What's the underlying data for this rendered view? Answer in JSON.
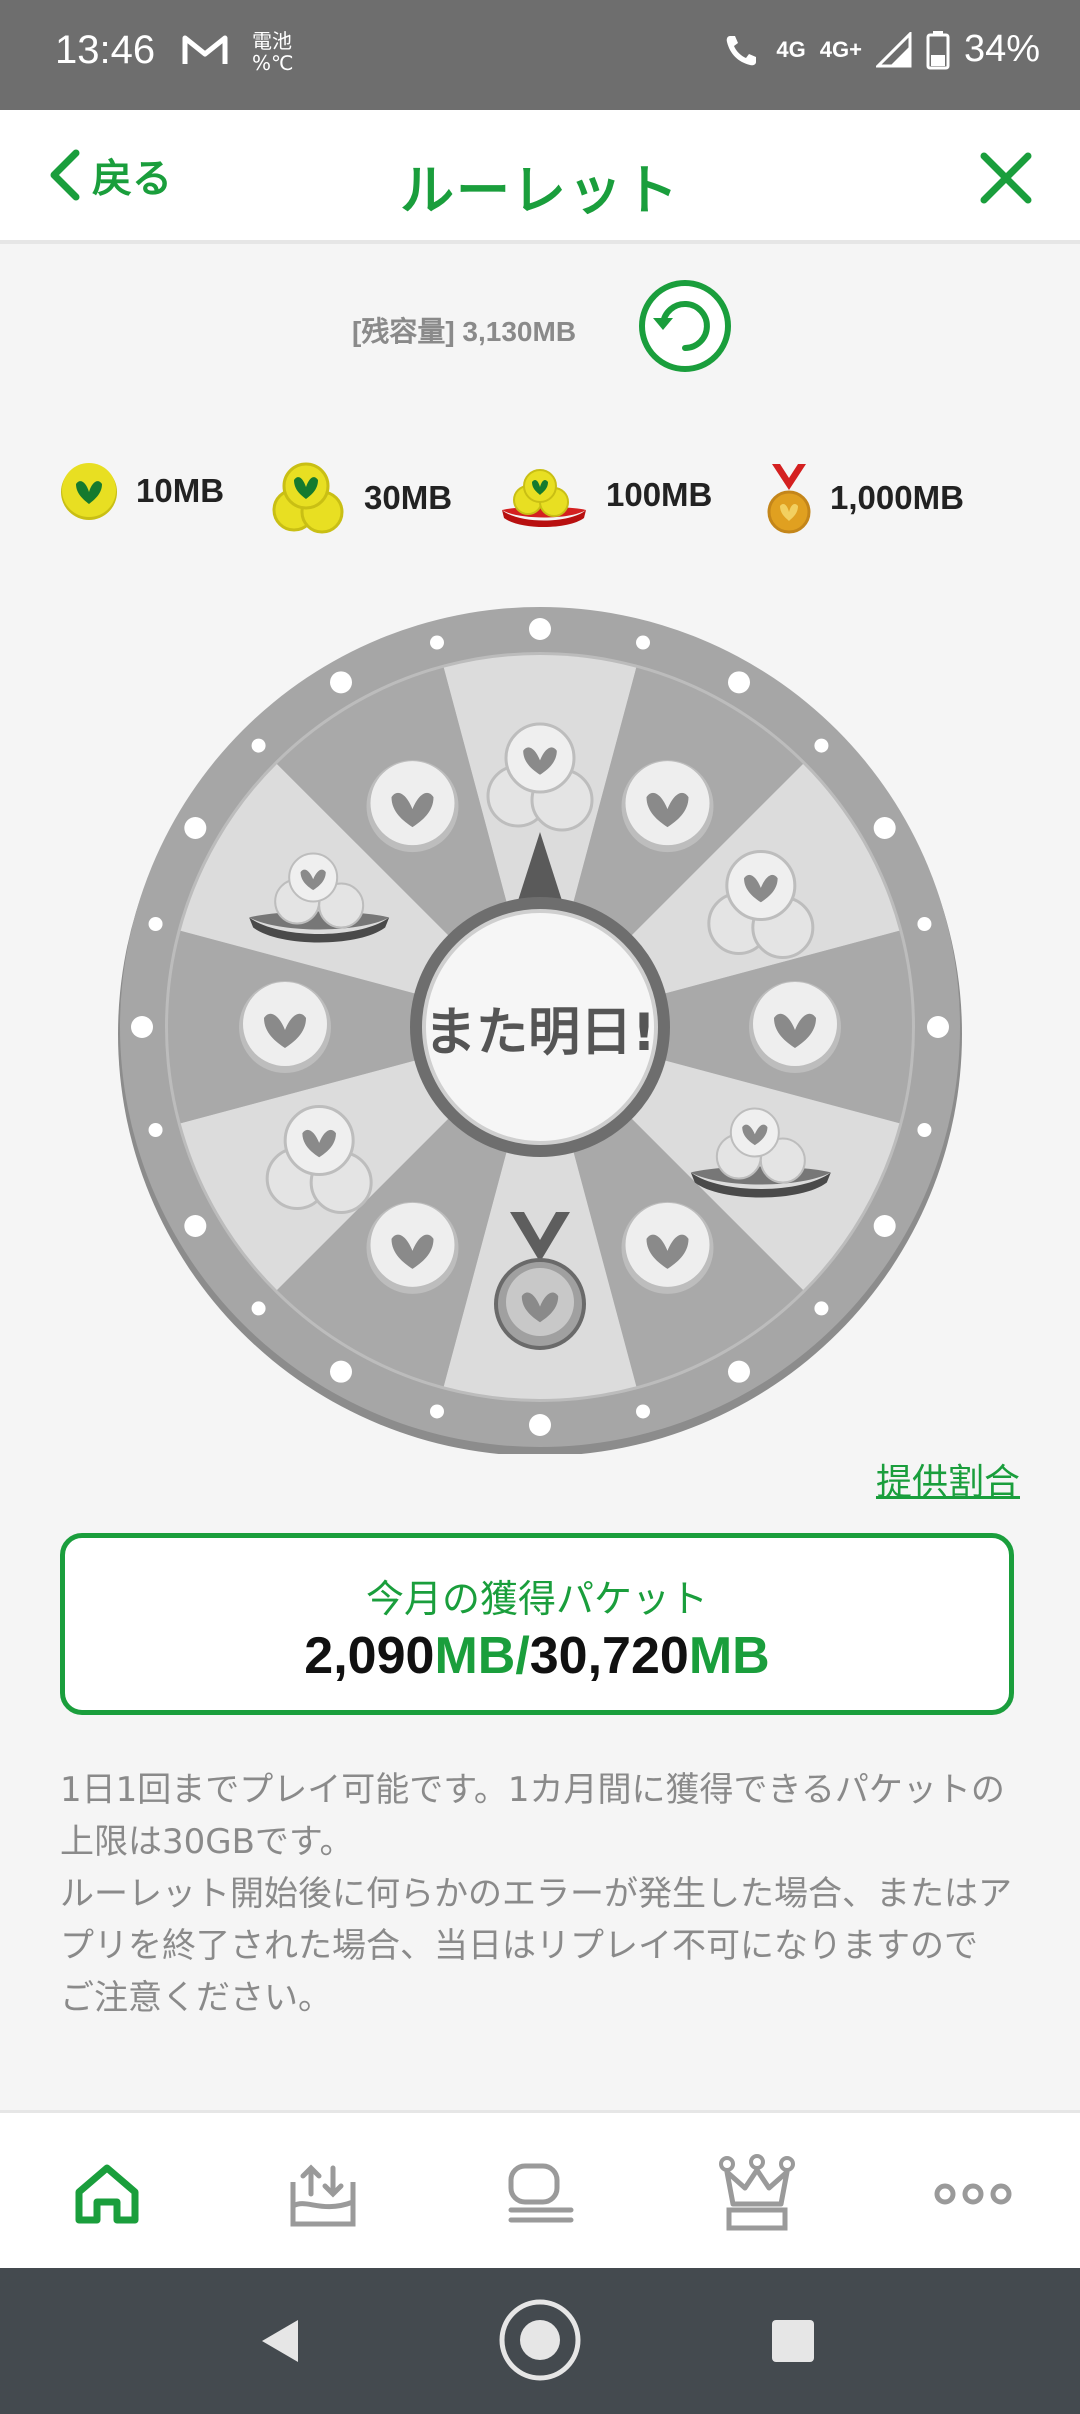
{
  "status_bar": {
    "time": "13:46",
    "battery_saver_line1": "電池",
    "battery_saver_line2": "%℃",
    "network_left": "4G",
    "network_right": "4G+",
    "battery": "34%"
  },
  "header": {
    "back_label": "戻る",
    "title": "ルーレット",
    "icons": {
      "back": "chevron-left-icon",
      "close": "close-icon"
    }
  },
  "remaining": {
    "label": "[残容量] 3,130MB"
  },
  "prizes": [
    {
      "label": "10MB",
      "icon": "single-coin-icon"
    },
    {
      "label": "30MB",
      "icon": "coin-stack-icon"
    },
    {
      "label": "100MB",
      "icon": "coin-pile-icon"
    },
    {
      "label": "1,000MB",
      "icon": "medal-icon"
    }
  ],
  "wheel": {
    "center_text": "また明日!",
    "segments": [
      "30MB",
      "10MB",
      "30MB",
      "10MB",
      "100MB",
      "10MB",
      "1,000MB",
      "10MB",
      "30MB",
      "10MB",
      "100MB",
      "10MB"
    ]
  },
  "rate_link": "提供割合",
  "packet": {
    "title": "今月の獲得パケット",
    "acquired": "2,090",
    "unit": "MB",
    "separator": "/",
    "limit": "30,720"
  },
  "notice": {
    "line1": "1日1回までプレイ可能です。1カ月間に獲得できるパケットの上限は30GBです。",
    "line2": "ルーレット開始後に何らかのエラーが発生した場合、またはアプリを終了された場合、当日はリプレイ不可になりますので",
    "line3": "ご注意ください。"
  },
  "bottom_nav": [
    "home-icon",
    "data-charge-icon",
    "chat-icon",
    "crown-ranking-icon",
    "more-icon"
  ],
  "colors": {
    "accent": "#1a9e3c",
    "coin_yellow": "#e8df22",
    "wheel_gray": "#a8a8a8"
  }
}
